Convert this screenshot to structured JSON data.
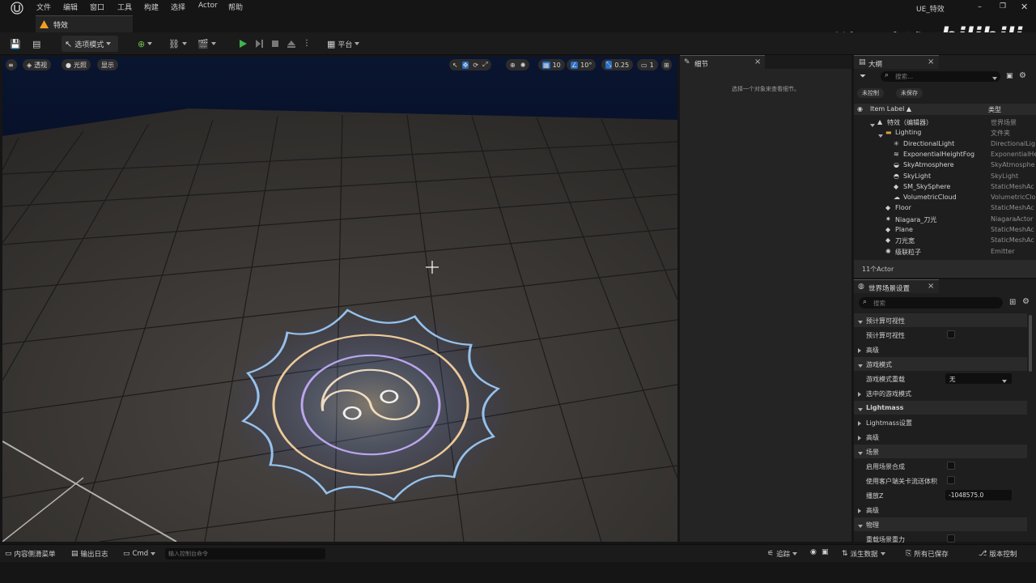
{
  "menu": [
    "文件",
    "编辑",
    "窗口",
    "工具",
    "构建",
    "选择",
    "Actor",
    "帮助"
  ],
  "window": {
    "project_title": "UE_特效",
    "tab_label": "特效"
  },
  "watermark": {
    "author": "乔治-周士诚",
    "logo": "bilibili"
  },
  "toolbar": {
    "mode_label": "选项模式",
    "platform_label": "平台"
  },
  "viewport": {
    "perspective": "透视",
    "lighting": "光照",
    "show": "显示",
    "grid_snap": "10",
    "rot_snap": "10°",
    "scale_snap": "0.25",
    "camera_speed": "1"
  },
  "details": {
    "tab": "细节",
    "empty_hint": "选择一个对象来查看细节。"
  },
  "outliner": {
    "tab": "大纲",
    "search_placeholder": "搜索...",
    "filter_unsaved_ctrl": "未控制",
    "filter_unsaved": "未保存",
    "col_label": "Item Label ▲",
    "col_type": "类型",
    "items": [
      {
        "label": "特效（编辑器）",
        "type": "世界场景",
        "indent": 0,
        "icon": "world-icon"
      },
      {
        "label": "Lighting",
        "type": "文件夹",
        "indent": 1,
        "icon": "folder-icon"
      },
      {
        "label": "DirectionalLight",
        "type": "DirectionalLig",
        "indent": 2,
        "icon": "sun-icon"
      },
      {
        "label": "ExponentialHeightFog",
        "type": "ExponentialHe",
        "indent": 2,
        "icon": "fog-icon"
      },
      {
        "label": "SkyAtmosphere",
        "type": "SkyAtmosphe",
        "indent": 2,
        "icon": "atmosphere-icon"
      },
      {
        "label": "SkyLight",
        "type": "SkyLight",
        "indent": 2,
        "icon": "skylight-icon"
      },
      {
        "label": "SM_SkySphere",
        "type": "StaticMeshAc",
        "indent": 2,
        "icon": "mesh-icon"
      },
      {
        "label": "VolumetricCloud",
        "type": "VolumetricClo",
        "indent": 2,
        "icon": "cloud-icon"
      },
      {
        "label": "Floor",
        "type": "StaticMeshAc",
        "indent": 1,
        "icon": "mesh-icon"
      },
      {
        "label": "Niagara_刀光",
        "type": "NiagaraActor",
        "indent": 1,
        "icon": "niagara-icon"
      },
      {
        "label": "Plane",
        "type": "StaticMeshAc",
        "indent": 1,
        "icon": "mesh-icon"
      },
      {
        "label": "刀光宽",
        "type": "StaticMeshAc",
        "indent": 1,
        "icon": "mesh-icon"
      },
      {
        "label": "级联粒子",
        "type": "Emitter",
        "indent": 1,
        "icon": "emitter-icon"
      }
    ],
    "actor_count": "11个Actor"
  },
  "world_settings": {
    "tab": "世界场景设置",
    "search_placeholder": "搜索",
    "rows": [
      {
        "label": "预计算可视性",
        "kind": "category",
        "expanded": true
      },
      {
        "label": "预计算可视性",
        "kind": "checkbox"
      },
      {
        "label": "高级",
        "kind": "subgroup"
      },
      {
        "label": "游戏模式",
        "kind": "category",
        "expanded": true
      },
      {
        "label": "游戏模式重载",
        "kind": "dropdown",
        "value": "无"
      },
      {
        "label": "选中的游戏模式",
        "kind": "subgroup"
      },
      {
        "label": "Lightmass",
        "kind": "category",
        "expanded": true,
        "bold": true
      },
      {
        "label": "Lightmass设置",
        "kind": "subgroup"
      },
      {
        "label": "高级",
        "kind": "subgroup"
      },
      {
        "label": "场景",
        "kind": "category",
        "expanded": true
      },
      {
        "label": "启用场景合成",
        "kind": "checkbox"
      },
      {
        "label": "使用客户端关卡流送体积",
        "kind": "checkbox"
      },
      {
        "label": "播放Z",
        "kind": "number",
        "value": "-1048575.0"
      },
      {
        "label": "高级",
        "kind": "subgroup"
      },
      {
        "label": "物理",
        "kind": "category",
        "expanded": true
      },
      {
        "label": "重载场景重力",
        "kind": "checkbox"
      }
    ]
  },
  "statusbar": {
    "content_drawer": "内容侧滑菜单",
    "output_log": "输出日志",
    "cmd": "Cmd",
    "console_placeholder": "输入控制台命令",
    "trace": "追踪",
    "derived_data": "派生数据",
    "all_saved": "所有已保存",
    "revision_control": "版本控制"
  },
  "colors": {
    "accent": "#f0a020",
    "play_green": "#3fb34f",
    "panel": "#242424",
    "selected_blue": "#2a6fc9"
  }
}
